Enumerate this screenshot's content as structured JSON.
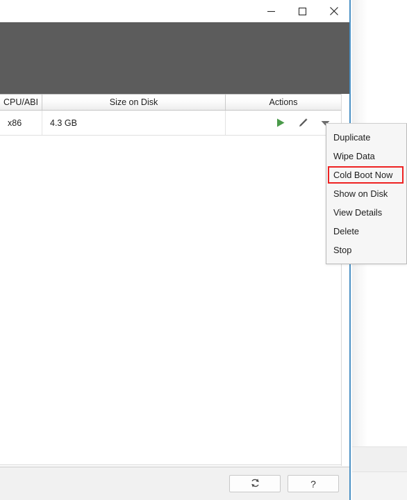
{
  "window": {
    "titlebar": {
      "minimize_label": "Minimize",
      "minimize_icon": "minimize-icon",
      "maximize_label": "Maximize",
      "maximize_icon": "maximize-icon",
      "close_label": "Close",
      "close_icon": "close-icon"
    },
    "border_color": "#4a90c4",
    "banner_color": "#5c5c5c"
  },
  "table": {
    "columns": [
      {
        "key": "cpu_abi",
        "label": "CPU/ABI"
      },
      {
        "key": "size_on_disk",
        "label": "Size on Disk"
      },
      {
        "key": "actions",
        "label": "Actions"
      }
    ],
    "rows": [
      {
        "cpu_abi": "x86",
        "size_on_disk": "4.3 GB",
        "actions": {
          "launch_icon": "play-icon",
          "launch_label": "Launch",
          "edit_icon": "pencil-icon",
          "edit_label": "Edit",
          "menu_icon": "chevron-down-icon",
          "menu_label": "More actions"
        }
      }
    ],
    "play_icon_color": "#4a9a4a",
    "pencil_icon_color": "#5a5a5a",
    "chevron_icon_color": "#6e6e6e"
  },
  "context_menu": {
    "highlight_color": "#ee2222",
    "highlighted_item": "Cold Boot Now",
    "items": [
      {
        "label": "Duplicate"
      },
      {
        "label": "Wipe Data"
      },
      {
        "label": "Cold Boot Now"
      },
      {
        "label": "Show on Disk"
      },
      {
        "label": "View Details"
      },
      {
        "label": "Delete"
      },
      {
        "label": "Stop"
      }
    ]
  },
  "footer": {
    "refresh_label": "↻",
    "refresh_icon": "refresh-icon",
    "refresh_name": "Refresh",
    "help_label": "?",
    "help_icon": "help-icon",
    "help_name": "Help"
  }
}
